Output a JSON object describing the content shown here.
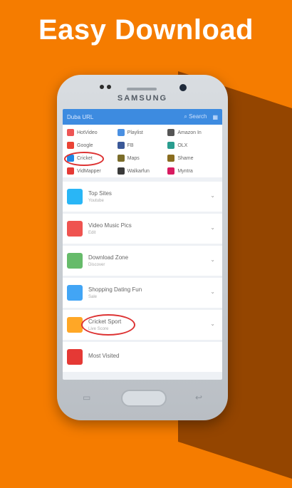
{
  "headline": "Easy Download",
  "phone": {
    "brand": "SAMSUNG"
  },
  "app": {
    "toolbar": {
      "title": "Duba URL",
      "search": "Search"
    },
    "shortcuts": [
      {
        "label": "HotVideo",
        "color": "#e55"
      },
      {
        "label": "Playlist",
        "color": "#4a90e2"
      },
      {
        "label": "Amazon In",
        "color": "#555"
      },
      {
        "label": "Google",
        "color": "#ea4335"
      },
      {
        "label": "FB",
        "color": "#3b5998"
      },
      {
        "label": "OLX",
        "color": "#2a9d8f"
      },
      {
        "label": "Cricket",
        "color": "#1e88e5"
      },
      {
        "label": "Maps",
        "color": "#7b6d2a"
      },
      {
        "label": "Shame",
        "color": "#8a6d1f"
      },
      {
        "label": "VidMapper",
        "color": "#e53935"
      },
      {
        "label": "Walkarfun",
        "color": "#3a3a3a"
      },
      {
        "label": "Myntra",
        "color": "#d81b60"
      }
    ],
    "categories": [
      {
        "title": "Top Sites",
        "sub": "Youtube",
        "color": "#29b6f6"
      },
      {
        "title": "Video  Music  Pics",
        "sub": "Edit",
        "color": "#ef5350"
      },
      {
        "title": "Download Zone",
        "sub": "Discover",
        "color": "#66bb6a"
      },
      {
        "title": "Shopping  Dating  Fun",
        "sub": "Sale",
        "color": "#42a5f5"
      },
      {
        "title": "Cricket  Sport",
        "sub": "Live Score",
        "color": "#ffa726"
      },
      {
        "title": "Most Visited",
        "sub": "",
        "color": "#e53935"
      }
    ]
  }
}
